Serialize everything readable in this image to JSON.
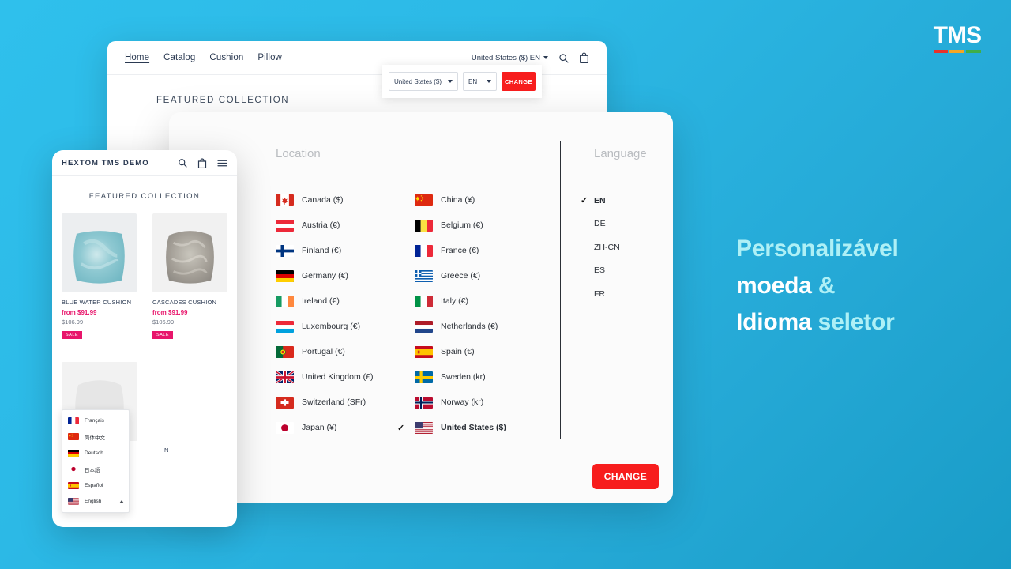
{
  "brand": {
    "logo_text": "TMS",
    "logo_bar_colors": [
      "#e8322a",
      "#f5a623",
      "#3fae49"
    ]
  },
  "theme": {
    "background_start": "#2fc0ec",
    "background_end": "#199cc7",
    "accent_red": "#f71d1d",
    "sale_pink": "#e8156b",
    "headline_cyan": "#aef0f6"
  },
  "back_window": {
    "nav_links": [
      {
        "label": "Home",
        "active": true
      },
      {
        "label": "Catalog",
        "active": false
      },
      {
        "label": "Cushion",
        "active": false
      },
      {
        "label": "Pillow",
        "active": false
      }
    ],
    "locale_trigger": "United States ($) EN",
    "icons": [
      "search-icon",
      "bag-icon"
    ],
    "featured_heading": "FEATURED COLLECTION",
    "locale_panel": {
      "country_value": "United States ($)",
      "language_value": "EN",
      "change_label": "CHANGE"
    }
  },
  "modal": {
    "location_title": "Location",
    "language_title": "Language",
    "change_label": "CHANGE",
    "locations": [
      {
        "name": "Canada ($)",
        "flag": "ca",
        "selected": false
      },
      {
        "name": "China (¥)",
        "flag": "cn",
        "selected": false
      },
      {
        "name": "Austria (€)",
        "flag": "at",
        "selected": false
      },
      {
        "name": "Belgium (€)",
        "flag": "be",
        "selected": false
      },
      {
        "name": "Finland (€)",
        "flag": "fi",
        "selected": false
      },
      {
        "name": "France (€)",
        "flag": "fr",
        "selected": false
      },
      {
        "name": "Germany (€)",
        "flag": "de",
        "selected": false
      },
      {
        "name": "Greece (€)",
        "flag": "gr",
        "selected": false
      },
      {
        "name": "Ireland (€)",
        "flag": "ie",
        "selected": false
      },
      {
        "name": "Italy (€)",
        "flag": "it",
        "selected": false
      },
      {
        "name": "Luxembourg (€)",
        "flag": "lu",
        "selected": false
      },
      {
        "name": "Netherlands (€)",
        "flag": "nl",
        "selected": false
      },
      {
        "name": "Portugal (€)",
        "flag": "pt",
        "selected": false
      },
      {
        "name": "Spain (€)",
        "flag": "es",
        "selected": false
      },
      {
        "name": "United Kingdom (£)",
        "flag": "gb",
        "selected": false
      },
      {
        "name": "Sweden (kr)",
        "flag": "se",
        "selected": false
      },
      {
        "name": "Switzerland (SFr)",
        "flag": "ch",
        "selected": false
      },
      {
        "name": "Norway (kr)",
        "flag": "no",
        "selected": false
      },
      {
        "name": "Japan (¥)",
        "flag": "jp",
        "selected": false
      },
      {
        "name": "United States ($)",
        "flag": "us",
        "selected": true
      }
    ],
    "languages": [
      {
        "code": "EN",
        "selected": true
      },
      {
        "code": "DE",
        "selected": false
      },
      {
        "code": "ZH-CN",
        "selected": false
      },
      {
        "code": "ES",
        "selected": false
      },
      {
        "code": "FR",
        "selected": false
      }
    ]
  },
  "phone": {
    "brand": "HEXTOM TMS DEMO",
    "icons": [
      "search-icon",
      "bag-icon",
      "menu-icon"
    ],
    "featured_heading": "FEATURED COLLECTION",
    "products": [
      {
        "name": "BLUE WATER CUSHION",
        "price": "from $91.99",
        "old_price": "$106.99",
        "badge": "SALE"
      },
      {
        "name": "CASCADES CUSHION",
        "price": "from $91.99",
        "old_price": "$106.99",
        "badge": "SALE"
      }
    ],
    "language_dropdown": [
      {
        "label": "Français",
        "flag": "fr"
      },
      {
        "label": "简体中文",
        "flag": "cn"
      },
      {
        "label": "Deutsch",
        "flag": "de"
      },
      {
        "label": "日本語",
        "flag": "jp"
      },
      {
        "label": "Español",
        "flag": "es"
      },
      {
        "label": "English",
        "flag": "us",
        "expanded": true
      }
    ]
  },
  "headline": {
    "line1": "Personalizável",
    "line2a": "moeda",
    "line2b": "&",
    "line3a": "Idioma",
    "line3b": "seletor"
  }
}
